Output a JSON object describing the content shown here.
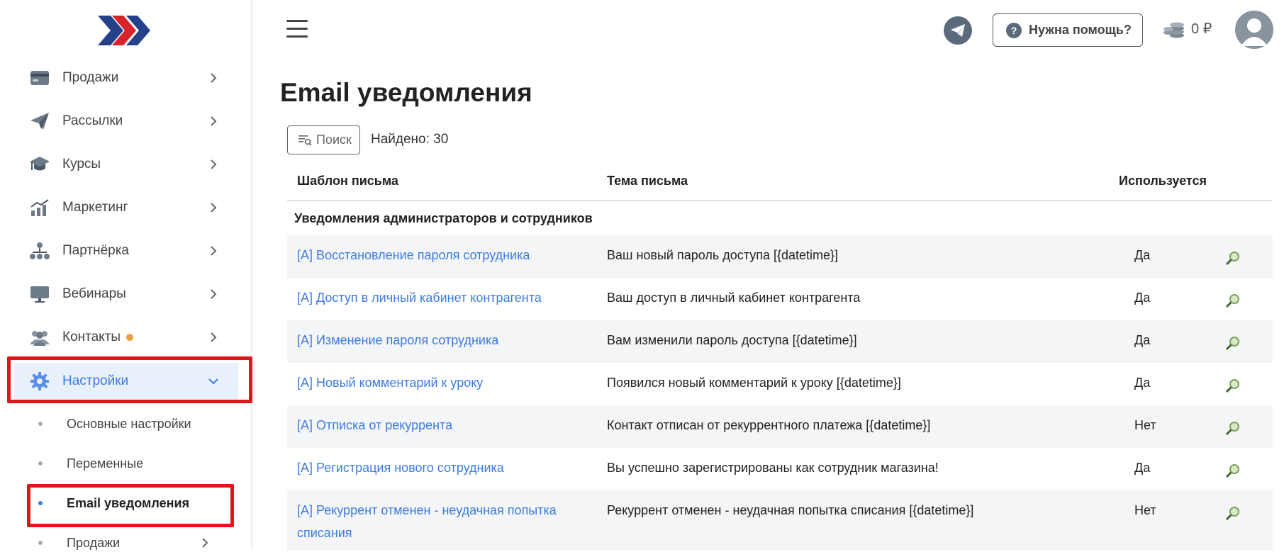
{
  "sidebar": {
    "items": [
      {
        "label": "Продажи",
        "icon": "card-icon"
      },
      {
        "label": "Рассылки",
        "icon": "paper-plane-icon"
      },
      {
        "label": "Курсы",
        "icon": "graduation-cap-icon"
      },
      {
        "label": "Маркетинг",
        "icon": "chart-growth-icon"
      },
      {
        "label": "Партнёрка",
        "icon": "network-icon"
      },
      {
        "label": "Вебинары",
        "icon": "monitor-icon"
      },
      {
        "label": "Контакты",
        "icon": "users-icon"
      },
      {
        "label": "Настройки",
        "icon": "gear-icon"
      }
    ],
    "sub_items": [
      {
        "label": "Основные настройки"
      },
      {
        "label": "Переменные"
      },
      {
        "label": "Email уведомления"
      },
      {
        "label": "Продажи"
      }
    ]
  },
  "header": {
    "help_label": "Нужна помощь?",
    "balance": "0 ₽"
  },
  "main": {
    "title": "Email уведомления",
    "search_label": "Поиск",
    "found_text": "Найдено: 30",
    "columns": [
      "Шаблон письма",
      "Тема письма",
      "Используется"
    ],
    "group_label": "Уведомления администраторов и сотрудников",
    "rows": [
      {
        "template": "[A] Восстановление пароля сотрудника",
        "subject": "Ваш новый пароль доступа [{datetime}]",
        "used": "Да"
      },
      {
        "template": "[A] Доступ в личный кабинет контрагента",
        "subject": "Ваш доступ в личный кабинет контрагента",
        "used": "Да"
      },
      {
        "template": "[A] Изменение пароля сотрудника",
        "subject": "Вам изменили пароль доступа [{datetime}]",
        "used": "Да"
      },
      {
        "template": "[A] Новый комментарий к уроку",
        "subject": "Появился новый комментарий к уроку [{datetime}]",
        "used": "Да"
      },
      {
        "template": "[A] Отписка от рекуррента",
        "subject": "Контакт отписан от рекуррентного платежа [{datetime}]",
        "used": "Нет"
      },
      {
        "template": "[A] Регистрация нового сотрудника",
        "subject": "Вы успешно зарегистрированы как сотрудник магазина!",
        "used": "Да"
      },
      {
        "template": "[A] Рекуррент отменен - неудачная попытка списания",
        "subject": "Рекуррент отменен - неудачная попытка списания [{datetime}]",
        "used": "Нет"
      }
    ]
  },
  "colors": {
    "accent": "#3c7be0",
    "highlight": "#e0141b",
    "badge": "#e8a33c"
  }
}
